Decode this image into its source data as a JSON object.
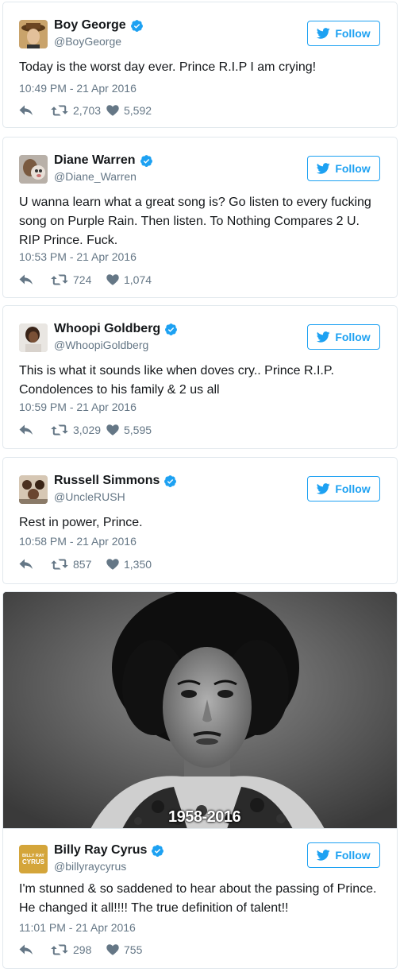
{
  "colors": {
    "accent": "#1da1f2",
    "muted": "#657786",
    "text": "#14171a",
    "like": "#657786"
  },
  "tweets": [
    {
      "display_name": "Boy George",
      "handle": "@BoyGeorge",
      "follow_label": "Follow",
      "text": "Today is the worst day ever. Prince R.I.P I am crying!",
      "timestamp": "10:49 PM - 21 Apr 2016",
      "retweets": "2,703",
      "likes": "5,592"
    },
    {
      "display_name": "Diane Warren",
      "handle": "@Diane_Warren",
      "follow_label": "Follow",
      "text": "U wanna learn what a great song is? Go listen to every fucking song on Purple Rain. Then listen. To Nothing Compares 2 U. RIP Prince. Fuck.",
      "timestamp": "10:53 PM - 21 Apr 2016",
      "retweets": "724",
      "likes": "1,074"
    },
    {
      "display_name": "Whoopi Goldberg",
      "handle": "@WhoopiGoldberg",
      "follow_label": "Follow",
      "text": "This is what it sounds like when doves cry.. Prince R.I.P. Condolences to his family & 2 us all",
      "timestamp": "10:59 PM - 21 Apr 2016",
      "retweets": "3,029",
      "likes": "5,595"
    },
    {
      "display_name": "Russell Simmons",
      "handle": "@UncleRUSH",
      "follow_label": "Follow",
      "text": "Rest in power, Prince.",
      "timestamp": "10:58 PM - 21 Apr 2016",
      "retweets": "857",
      "likes": "1,350"
    },
    {
      "display_name": "Billy Ray Cyrus",
      "handle": "@billyraycyrus",
      "follow_label": "Follow",
      "avatar_text_top": "BILLY RAY",
      "avatar_text_bottom": "CYRUS",
      "photo_caption": "1958-2016",
      "text": "I'm stunned & so saddened to hear about the passing of Prince. He changed it all!!!! The true definition of talent!!",
      "timestamp": "11:01 PM - 21 Apr 2016",
      "retweets": "298",
      "likes": "755"
    }
  ],
  "icons": [
    "verified-badge-icon",
    "twitter-bird-icon",
    "reply-icon",
    "retweet-icon",
    "heart-icon"
  ]
}
